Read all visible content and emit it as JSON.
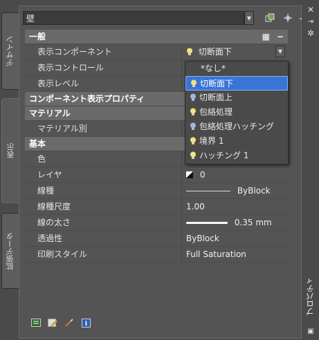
{
  "window": {
    "title": "プロパティ"
  },
  "left_tabs": [
    "デザイン",
    "表示",
    "拡張データ"
  ],
  "object_selector": {
    "value": "壁"
  },
  "categories": {
    "general": "一般",
    "component_props": "コンポーネント表示プロパティ",
    "material": "マテリアル",
    "basic": "基本"
  },
  "rows": {
    "display_component": {
      "label": "表示コンポーネント",
      "value": "切断面下"
    },
    "display_control": {
      "label": "表示コントロール",
      "value": ""
    },
    "display_level": {
      "label": "表示レベル",
      "value": ""
    },
    "material_by": {
      "label": "マテリアル別",
      "value": ""
    },
    "color": {
      "label": "色",
      "value": ""
    },
    "layer": {
      "label": "レイヤ",
      "value": "0"
    },
    "linetype": {
      "label": "線種",
      "value": "ByBlock"
    },
    "linetype_scale": {
      "label": "線種尺度",
      "value": "1.00"
    },
    "lineweight": {
      "label": "線の太さ",
      "value": "0.35 mm"
    },
    "transparency": {
      "label": "透過性",
      "value": "ByBlock"
    },
    "plot_style": {
      "label": "印刷スタイル",
      "value": "Full Saturation"
    }
  },
  "dropdown": {
    "items": [
      "*なし*",
      "切断面下",
      "切断面上",
      "包絡処理",
      "包絡処理ハッチング",
      "境界 1",
      "ハッチング 1"
    ],
    "selected": "切断面下"
  },
  "colors": {
    "selection": "#3875d7",
    "bulb": "#f3e37a"
  }
}
